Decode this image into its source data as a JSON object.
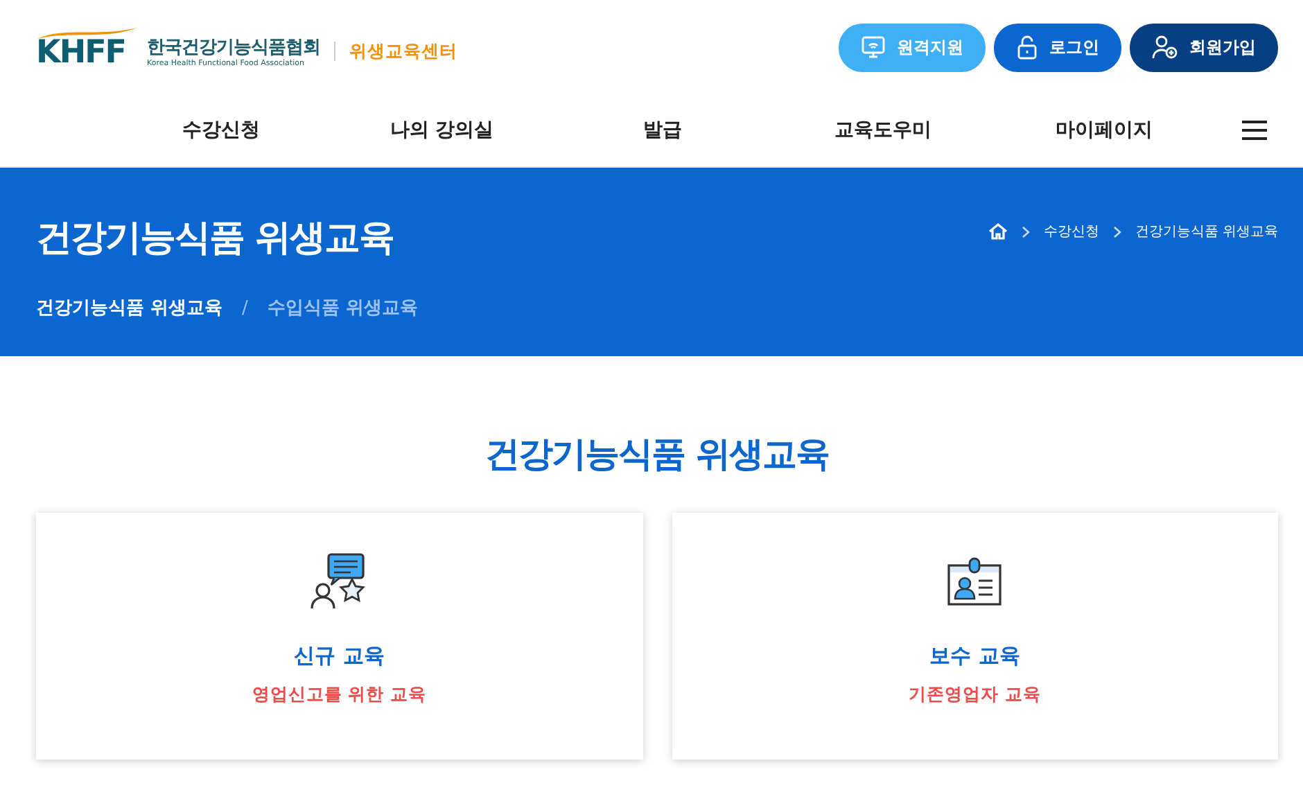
{
  "logo": {
    "mark": "KHFF",
    "name": "한국건강기능식품협회",
    "subtitle": "Korea Health Functional Food Association",
    "center": "위생교육센터"
  },
  "top_buttons": [
    {
      "kind": "remote",
      "label": "원격지원"
    },
    {
      "kind": "login",
      "label": "로그인"
    },
    {
      "kind": "join",
      "label": "회원가입"
    }
  ],
  "nav": [
    "수강신청",
    "나의 강의실",
    "발급",
    "교육도우미",
    "마이페이지"
  ],
  "banner": {
    "title": "건강기능식품 위생교육",
    "breadcrumb": [
      "수강신청",
      "건강기능식품 위생교육"
    ],
    "tabs": [
      {
        "label": "건강기능식품 위생교육",
        "selected": true
      },
      {
        "label": "수입식품 위생교육",
        "selected": false
      }
    ],
    "separator": "/"
  },
  "section_title": "건강기능식품 위생교육",
  "cards": [
    {
      "kind": "new",
      "title": "신규 교육",
      "subtitle": "영업신고를 위한 교육"
    },
    {
      "kind": "refresher",
      "title": "보수 교육",
      "subtitle": "기존영업자 교육"
    }
  ]
}
